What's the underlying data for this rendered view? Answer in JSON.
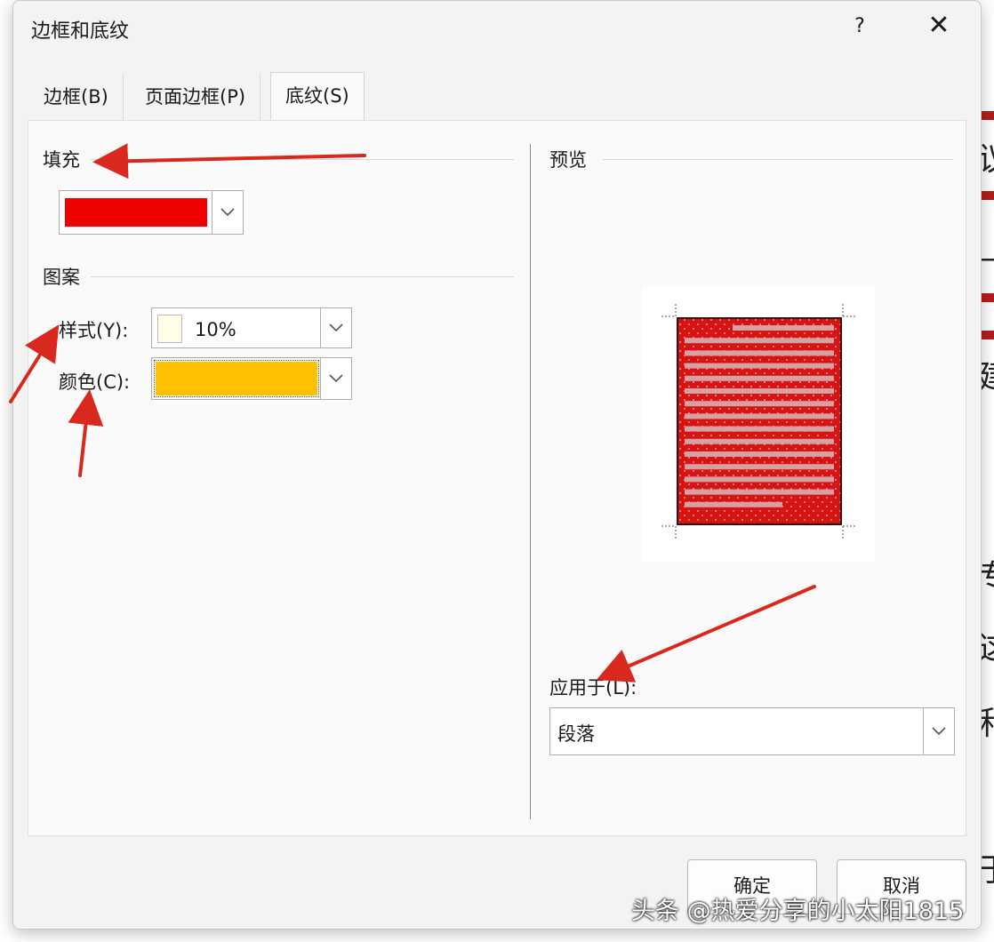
{
  "dialog": {
    "title": "边框和底纹",
    "help_label": "?",
    "close_label": "✕"
  },
  "tabs": [
    {
      "label": "边框(B)",
      "active": false
    },
    {
      "label": "页面边框(P)",
      "active": false
    },
    {
      "label": "底纹(S)",
      "active": true
    }
  ],
  "fill": {
    "label": "填充",
    "color": "#f00000"
  },
  "pattern": {
    "label": "图案",
    "style_label": "样式(Y):",
    "style_value": "10%",
    "color_label": "颜色(C):",
    "color_value": "#ffc000"
  },
  "preview": {
    "label": "预览",
    "shade_color": "#d71414",
    "text_line_color": "#d8a0a0"
  },
  "apply_to": {
    "label": "应用于(L):",
    "value": "段落"
  },
  "buttons": {
    "ok": "确定",
    "cancel": "取消"
  },
  "watermark": "头条 @热爱分享的小太阳1815",
  "annotation_color": "#d9281e"
}
